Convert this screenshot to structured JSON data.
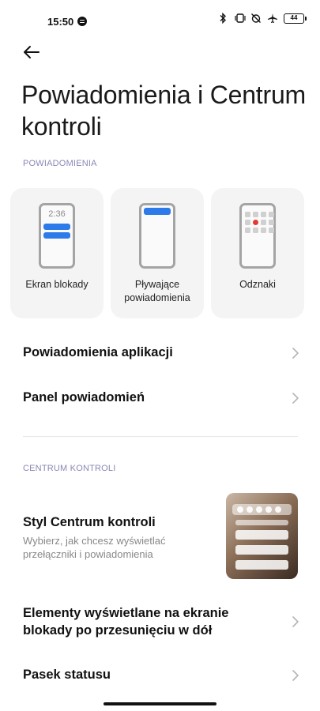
{
  "status_bar": {
    "time": "15:50",
    "battery": "44",
    "icons": [
      "spotify-icon",
      "bluetooth-icon",
      "vibrate-icon",
      "alarm-off-icon",
      "airplane-icon",
      "battery-icon"
    ]
  },
  "header": {
    "title": "Powiadomienia i Centrum kontroli"
  },
  "notifications_section": {
    "header": "POWIADOMIENIA",
    "cards": [
      {
        "label": "Ekran blokady",
        "preview_time": "2:36"
      },
      {
        "label": "Pływające powiadomienia"
      },
      {
        "label": "Odznaki"
      }
    ],
    "rows": [
      {
        "title": "Powiadomienia aplikacji"
      },
      {
        "title": "Panel powiadomień"
      }
    ]
  },
  "control_center_section": {
    "header": "CENTRUM KONTROLI",
    "style_row": {
      "title": "Styl Centrum kontroli",
      "subtitle": "Wybierz, jak chcesz wyświetlać przełączniki i powiadomienia"
    },
    "rows": [
      {
        "title": "Elementy wyświetlane na ekranie blokady po przesunięciu w dół"
      },
      {
        "title": "Pasek statusu"
      }
    ]
  },
  "colors": {
    "accent_blue": "#2d7bea",
    "section_header": "#8a87b5",
    "badge_red": "#e53935"
  }
}
